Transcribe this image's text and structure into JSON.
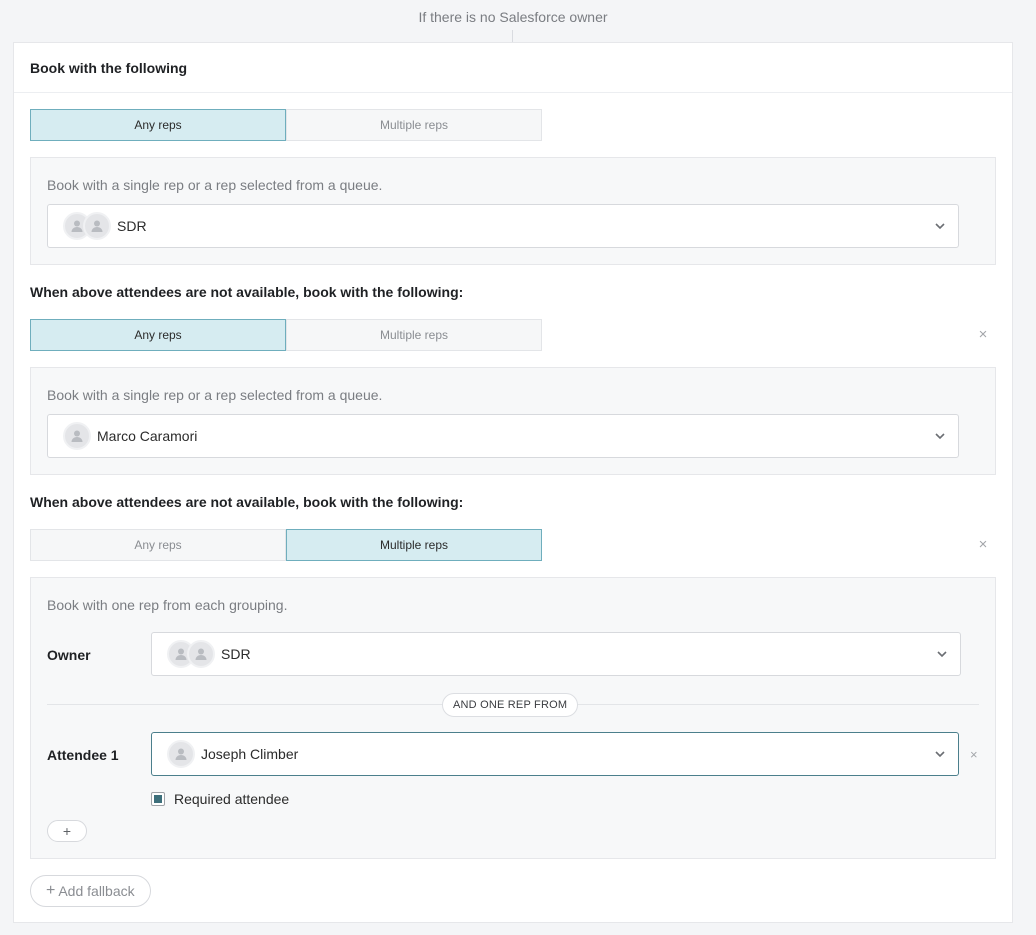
{
  "top_caption": "If there is no Salesforce owner",
  "card": {
    "title": "Book with the following",
    "fallback_button": "Add fallback"
  },
  "sections": [
    {
      "title": "",
      "tabs": [
        "Any reps",
        "Multiple reps"
      ],
      "active_tab": 0,
      "description": "Book with a single rep or a rep selected from a queue.",
      "selected": "SDR"
    },
    {
      "title": "When above attendees are not available, book with the following:",
      "tabs": [
        "Any reps",
        "Multiple reps"
      ],
      "active_tab": 0,
      "description": "Book with a single rep or a rep selected from a queue.",
      "selected": "Marco Caramori"
    },
    {
      "title": "When above attendees are not available, book with the following:",
      "tabs": [
        "Any reps",
        "Multiple reps"
      ],
      "active_tab": 1,
      "description": "Book with one rep from each grouping.",
      "owner_label": "Owner",
      "owner_selected": "SDR",
      "separator": "AND ONE REP FROM",
      "attendee_label": "Attendee 1",
      "attendee_selected": "Joseph Climber",
      "required_label": "Required attendee",
      "required_checked": true,
      "add_button": "+"
    }
  ],
  "icons": {
    "remove": "×",
    "dropdown": "chevron-down-icon",
    "avatar": "user-silhouette-icon"
  },
  "colors": {
    "active_tab_bg": "#d6ecf1",
    "active_tab_border": "#6faebd",
    "checkbox_fill": "#3d6f7b"
  }
}
